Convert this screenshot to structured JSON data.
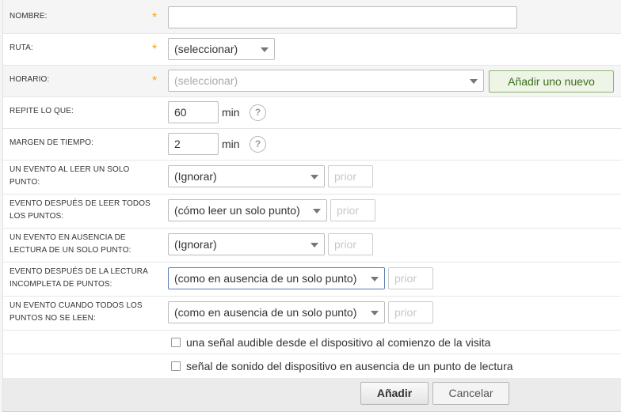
{
  "form": {
    "name": {
      "label": "NOMBRE:",
      "required": "*",
      "value": ""
    },
    "route": {
      "label": "RUTA:",
      "required": "*",
      "value": "(seleccionar)"
    },
    "schedule": {
      "label": "HORARIO:",
      "required": "*",
      "value": "(seleccionar)",
      "add_button": "Añadir uno nuevo"
    },
    "repeat": {
      "label": "REPITE LO QUE:",
      "value": "60",
      "unit": "min",
      "help": "?"
    },
    "margin": {
      "label": "MARGEN DE TIEMPO:",
      "value": "2",
      "unit": "min",
      "help": "?"
    },
    "events": [
      {
        "label_line1": "UN EVENTO AL LEER UN SOLO",
        "label_line2": "PUNTO:",
        "value": "(Ignorar)",
        "priority_placeholder": "prior"
      },
      {
        "label_line1": "EVENTO DESPUÉS DE LEER TODOS",
        "label_line2": "LOS PUNTOS:",
        "value": "(cómo leer un solo punto)",
        "priority_placeholder": "prior"
      },
      {
        "label_line1": "UN EVENTO EN AUSENCIA DE",
        "label_line2": "LECTURA DE UN SOLO PUNTO:",
        "value": "(Ignorar)",
        "priority_placeholder": "prior"
      },
      {
        "label_line1": "EVENTO DESPUÉS DE LA LECTURA",
        "label_line2": "INCOMPLETA DE PUNTOS:",
        "value": "(como en ausencia de un solo punto)",
        "priority_placeholder": "prior"
      },
      {
        "label_line1": "UN EVENTO CUANDO TODOS LOS",
        "label_line2": "PUNTOS NO SE LEEN:",
        "value": "(como en ausencia de un solo punto)",
        "priority_placeholder": "prior"
      }
    ],
    "checkboxes": [
      {
        "label": "una señal audible desde el dispositivo al comienzo de la visita",
        "checked": false
      },
      {
        "label": "señal de sonido del dispositivo en ausencia de un punto de lectura",
        "checked": false
      }
    ]
  },
  "footer": {
    "submit_label": "Añadir",
    "cancel_label": "Cancelar"
  },
  "colors": {
    "required_star": "#f3a712",
    "add_new_border": "#8bb56b",
    "add_new_text": "#3a6e1d"
  },
  "icons": {
    "select_caret": "chevron-down-icon",
    "help": "question-circle-icon",
    "checkbox": "checkbox-icon"
  }
}
